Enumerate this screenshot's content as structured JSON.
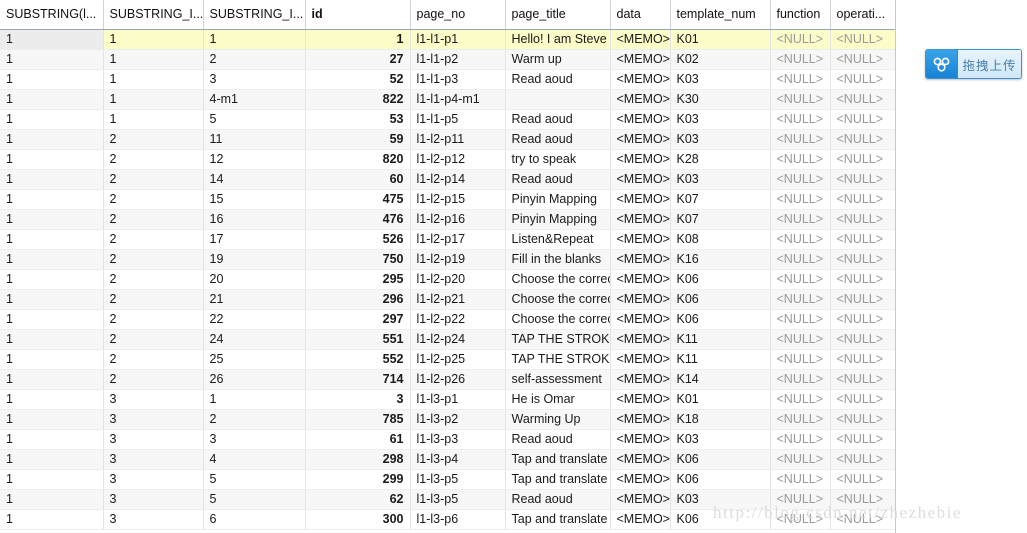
{
  "grid": {
    "columns": [
      {
        "label": "SUBSTRING(l...",
        "key": "c0",
        "align": "left",
        "bold": false
      },
      {
        "label": "SUBSTRING_I...",
        "key": "c1",
        "align": "left",
        "bold": false
      },
      {
        "label": "SUBSTRING_I...",
        "key": "c2",
        "align": "left",
        "bold": false
      },
      {
        "label": "id",
        "key": "c3",
        "align": "right",
        "bold": true
      },
      {
        "label": "page_no",
        "key": "c4",
        "align": "left",
        "bold": false
      },
      {
        "label": "page_title",
        "key": "c5",
        "align": "left",
        "bold": false
      },
      {
        "label": "data",
        "key": "c6",
        "align": "left",
        "bold": false
      },
      {
        "label": "template_num",
        "key": "c7",
        "align": "left",
        "bold": false
      },
      {
        "label": "function",
        "key": "c8",
        "align": "left",
        "bold": false
      },
      {
        "label": "operati...",
        "key": "c9",
        "align": "left",
        "bold": false
      }
    ],
    "null_text": "<NULL>",
    "memo_text": "<MEMO>",
    "current_row_index": 0,
    "current_cell_column": 0,
    "rows": [
      {
        "c0": "1",
        "c1": "1",
        "c2": "1",
        "c3": "1",
        "c4": "l1-l1-p1",
        "c5": "Hello! I am Steve",
        "c6": "<MEMO>",
        "c7": "K01",
        "c8": "<NULL>",
        "c9": "<NULL>"
      },
      {
        "c0": "1",
        "c1": "1",
        "c2": "2",
        "c3": "27",
        "c4": "l1-l1-p2",
        "c5": "Warm up",
        "c6": "<MEMO>",
        "c7": "K02",
        "c8": "<NULL>",
        "c9": "<NULL>"
      },
      {
        "c0": "1",
        "c1": "1",
        "c2": "3",
        "c3": "52",
        "c4": "l1-l1-p3",
        "c5": "Read aoud",
        "c6": "<MEMO>",
        "c7": "K03",
        "c8": "<NULL>",
        "c9": "<NULL>"
      },
      {
        "c0": "1",
        "c1": "1",
        "c2": "4-m1",
        "c3": "822",
        "c4": "l1-l1-p4-m1",
        "c5": "",
        "c6": "<MEMO>",
        "c7": "K30",
        "c8": "<NULL>",
        "c9": "<NULL>"
      },
      {
        "c0": "1",
        "c1": "1",
        "c2": "5",
        "c3": "53",
        "c4": "l1-l1-p5",
        "c5": "Read aoud",
        "c6": "<MEMO>",
        "c7": "K03",
        "c8": "<NULL>",
        "c9": "<NULL>"
      },
      {
        "c0": "1",
        "c1": "2",
        "c2": "11",
        "c3": "59",
        "c4": "l1-l2-p11",
        "c5": "Read aoud",
        "c6": "<MEMO>",
        "c7": "K03",
        "c8": "<NULL>",
        "c9": "<NULL>"
      },
      {
        "c0": "1",
        "c1": "2",
        "c2": "12",
        "c3": "820",
        "c4": "l1-l2-p12",
        "c5": "try to speak",
        "c6": "<MEMO>",
        "c7": "K28",
        "c8": "<NULL>",
        "c9": "<NULL>"
      },
      {
        "c0": "1",
        "c1": "2",
        "c2": "14",
        "c3": "60",
        "c4": "l1-l2-p14",
        "c5": "Read aoud",
        "c6": "<MEMO>",
        "c7": "K03",
        "c8": "<NULL>",
        "c9": "<NULL>"
      },
      {
        "c0": "1",
        "c1": "2",
        "c2": "15",
        "c3": "475",
        "c4": "l1-l2-p15",
        "c5": "Pinyin Mapping",
        "c6": "<MEMO>",
        "c7": "K07",
        "c8": "<NULL>",
        "c9": "<NULL>"
      },
      {
        "c0": "1",
        "c1": "2",
        "c2": "16",
        "c3": "476",
        "c4": "l1-l2-p16",
        "c5": "Pinyin Mapping",
        "c6": "<MEMO>",
        "c7": "K07",
        "c8": "<NULL>",
        "c9": "<NULL>"
      },
      {
        "c0": "1",
        "c1": "2",
        "c2": "17",
        "c3": "526",
        "c4": "l1-l2-p17",
        "c5": "Listen&Repeat",
        "c6": "<MEMO>",
        "c7": "K08",
        "c8": "<NULL>",
        "c9": "<NULL>"
      },
      {
        "c0": "1",
        "c1": "2",
        "c2": "19",
        "c3": "750",
        "c4": "l1-l2-p19",
        "c5": "Fill in the blanks",
        "c6": "<MEMO>",
        "c7": "K16",
        "c8": "<NULL>",
        "c9": "<NULL>"
      },
      {
        "c0": "1",
        "c1": "2",
        "c2": "20",
        "c3": "295",
        "c4": "l1-l2-p20",
        "c5": "Choose the correct",
        "c6": "<MEMO>",
        "c7": "K06",
        "c8": "<NULL>",
        "c9": "<NULL>"
      },
      {
        "c0": "1",
        "c1": "2",
        "c2": "21",
        "c3": "296",
        "c4": "l1-l2-p21",
        "c5": "Choose the correct",
        "c6": "<MEMO>",
        "c7": "K06",
        "c8": "<NULL>",
        "c9": "<NULL>"
      },
      {
        "c0": "1",
        "c1": "2",
        "c2": "22",
        "c3": "297",
        "c4": "l1-l2-p22",
        "c5": "Choose the correct",
        "c6": "<MEMO>",
        "c7": "K06",
        "c8": "<NULL>",
        "c9": "<NULL>"
      },
      {
        "c0": "1",
        "c1": "2",
        "c2": "24",
        "c3": "551",
        "c4": "l1-l2-p24",
        "c5": " TAP THE STROKE",
        "c6": "<MEMO>",
        "c7": "K11",
        "c8": "<NULL>",
        "c9": "<NULL>"
      },
      {
        "c0": "1",
        "c1": "2",
        "c2": "25",
        "c3": "552",
        "c4": "l1-l2-p25",
        "c5": " TAP THE STROKE",
        "c6": "<MEMO>",
        "c7": "K11",
        "c8": "<NULL>",
        "c9": "<NULL>"
      },
      {
        "c0": "1",
        "c1": "2",
        "c2": "26",
        "c3": "714",
        "c4": "l1-l2-p26",
        "c5": "self-assessment",
        "c6": "<MEMO>",
        "c7": "K14",
        "c8": "<NULL>",
        "c9": "<NULL>"
      },
      {
        "c0": "1",
        "c1": "3",
        "c2": "1",
        "c3": "3",
        "c4": "l1-l3-p1",
        "c5": "He is Omar",
        "c6": "<MEMO>",
        "c7": "K01",
        "c8": "<NULL>",
        "c9": "<NULL>"
      },
      {
        "c0": "1",
        "c1": "3",
        "c2": "2",
        "c3": "785",
        "c4": "l1-l3-p2",
        "c5": "Warming Up",
        "c6": "<MEMO>",
        "c7": "K18",
        "c8": "<NULL>",
        "c9": "<NULL>"
      },
      {
        "c0": "1",
        "c1": "3",
        "c2": "3",
        "c3": "61",
        "c4": "l1-l3-p3",
        "c5": "Read aoud",
        "c6": "<MEMO>",
        "c7": "K03",
        "c8": "<NULL>",
        "c9": "<NULL>"
      },
      {
        "c0": "1",
        "c1": "3",
        "c2": "4",
        "c3": "298",
        "c4": "l1-l3-p4",
        "c5": "Tap and translate",
        "c6": "<MEMO>",
        "c7": "K06",
        "c8": "<NULL>",
        "c9": "<NULL>"
      },
      {
        "c0": "1",
        "c1": "3",
        "c2": "5",
        "c3": "299",
        "c4": "l1-l3-p5",
        "c5": "Tap and translate",
        "c6": "<MEMO>",
        "c7": "K06",
        "c8": "<NULL>",
        "c9": "<NULL>"
      },
      {
        "c0": "1",
        "c1": "3",
        "c2": "5",
        "c3": "62",
        "c4": "l1-l3-p5",
        "c5": "Read aoud",
        "c6": "<MEMO>",
        "c7": "K03",
        "c8": "<NULL>",
        "c9": "<NULL>"
      },
      {
        "c0": "1",
        "c1": "3",
        "c2": "6",
        "c3": "300",
        "c4": "l1-l3-p6",
        "c5": "Tap and translate",
        "c6": "<MEMO>",
        "c7": "K06",
        "c8": "<NULL>",
        "c9": "<NULL>"
      }
    ]
  },
  "upload_widget": {
    "label": "拖拽上传",
    "icon": "baidu-cloud-icon",
    "icon_color": "#ffffff",
    "button_color": "#1a82d4",
    "label_color": "#4a7fa8"
  },
  "watermark": {
    "text": "http://blog.csdn.net/zhezhebie",
    "color": "#dcdcdc"
  }
}
